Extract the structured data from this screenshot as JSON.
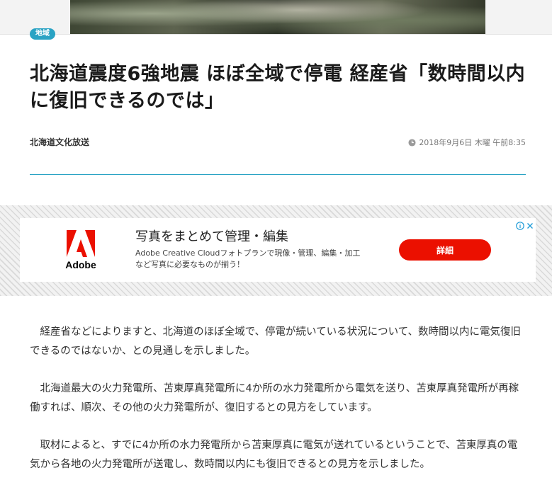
{
  "article": {
    "category": "地域",
    "title": "北海道震度6強地震 ほぼ全域で停電 経産省「数時間以内に復旧できるのでは」",
    "source": "北海道文化放送",
    "date": "2018年9月6日 木曜 午前8:35",
    "paragraphs": [
      "経産省などによりますと、北海道のほぼ全域で、停電が続いている状況について、数時間以内に電気復旧できるのではないか、との見通しを示しました。",
      "北海道最大の火力発電所、苫東厚真発電所に4か所の水力発電所から電気を送り、苫東厚真発電所が再稼働すれば、順次、その他の火力発電所が、復旧するとの見方をしています。",
      "取材によると、すでに4か所の水力発電所から苫東厚真に電気が送れているということで、苫東厚真の電気から各地の火力発電所が送電し、数時間以内にも復旧できるとの見方を示しました。"
    ]
  },
  "ad": {
    "logo_text": "Adobe",
    "headline": "写真をまとめて管理・編集",
    "description": "Adobe Creative Cloudフォトプランで現像・管理、編集・加工など写真に必要なものが揃う！",
    "cta_label": "詳細"
  },
  "colors": {
    "accent": "#2aa3c4",
    "adobe_red": "#eb1000",
    "cta_red": "#eb1000"
  },
  "icons": {
    "clock": "clock-icon",
    "ad_info": "info-icon",
    "ad_close": "close-icon"
  }
}
